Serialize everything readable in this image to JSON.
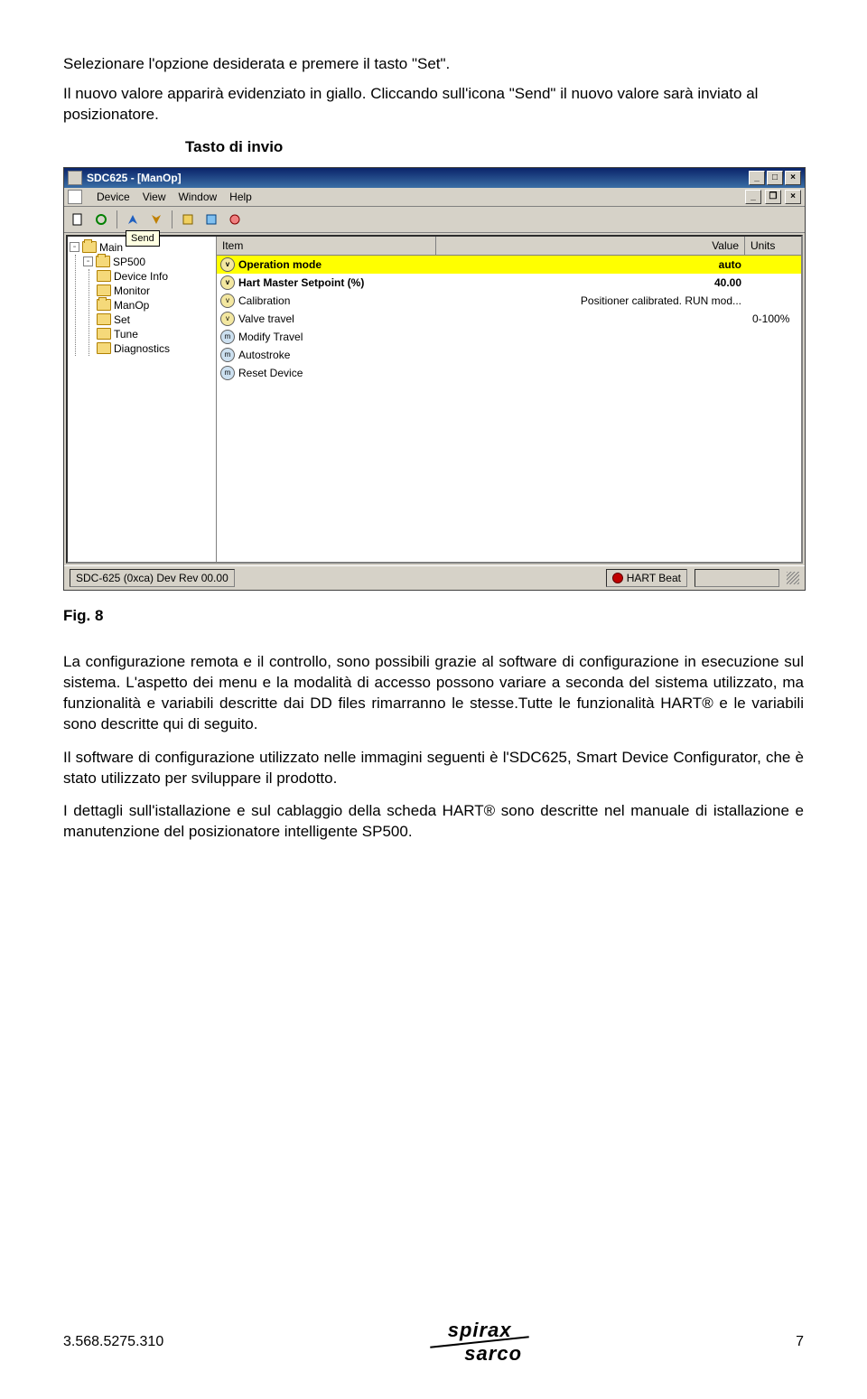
{
  "intro": {
    "p1": "Selezionare l'opzione desiderata e premere il tasto \"Set\".",
    "p2": "Il nuovo valore apparirà evidenziato in giallo. Cliccando sull'icona \"Send\" il nuovo valore sarà inviato al posizionatore."
  },
  "callout": "Tasto di invio",
  "app": {
    "title": "SDC625 - [ManOp]",
    "menu": [
      "Device",
      "View",
      "Window",
      "Help"
    ],
    "tooltip": "Send",
    "tree": {
      "root": "Main",
      "sp": "SP500",
      "items": [
        "Device Info",
        "Monitor",
        "ManOp",
        "Set",
        "Tune",
        "Diagnostics"
      ]
    },
    "columns": {
      "item": "Item",
      "value": "Value",
      "units": "Units"
    },
    "rows": [
      {
        "type": "var",
        "label": "Operation mode",
        "value": "auto",
        "units": "",
        "hl": true,
        "bold": true
      },
      {
        "type": "var",
        "label": "Hart Master Setpoint (%)",
        "value": "40.00",
        "units": "",
        "hl": false,
        "bold": true
      },
      {
        "type": "var",
        "label": "Calibration",
        "value": "Positioner calibrated. RUN mod...",
        "units": "",
        "hl": false,
        "bold": false
      },
      {
        "type": "var",
        "label": "Valve travel",
        "value": "",
        "units": "0-100%",
        "hl": false,
        "bold": false
      },
      {
        "type": "meth",
        "label": "Modify Travel",
        "value": "",
        "units": "",
        "hl": false,
        "bold": false
      },
      {
        "type": "meth",
        "label": "Autostroke",
        "value": "",
        "units": "",
        "hl": false,
        "bold": false
      },
      {
        "type": "meth",
        "label": "Reset Device",
        "value": "",
        "units": "",
        "hl": false,
        "bold": false
      }
    ],
    "status_left": "SDC-625 (0xca) Dev Rev 00.00",
    "status_right": "HART Beat"
  },
  "figure": "Fig. 8",
  "body": {
    "p1": "La configurazione remota e il controllo, sono possibili grazie al software di configurazione in esecuzione sul sistema.",
    "p2": "L'aspetto dei menu e la modalità di accesso possono variare a seconda del sistema utilizzato, ma funzionalità e variabili descritte dai DD files rimarranno le stesse.Tutte le funzionalità HART® e le variabili sono descritte qui di seguito.",
    "p3": "Il software di configurazione utilizzato nelle immagini seguenti è l'SDC625, Smart Device Configurator, che è stato utilizzato per sviluppare il prodotto.",
    "p4": "I dettagli sull'istallazione e sul cablaggio della scheda HART® sono descritte nel manuale di istallazione e manutenzione del posizionatore intelligente SP500."
  },
  "footer": {
    "left": "3.568.5275.310",
    "brand_top": "spirax",
    "brand_bot": "sarco",
    "page": "7"
  }
}
